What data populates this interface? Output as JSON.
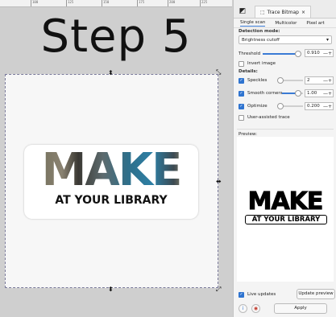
{
  "canvas": {
    "ruler_labels": [
      "100",
      "125",
      "150",
      "175",
      "200",
      "225"
    ],
    "step_title": "Step 5",
    "logo": {
      "main": "MAKE",
      "sub": "AT YOUR LIBRARY"
    }
  },
  "panel": {
    "tab_title": "Trace Bitmap",
    "tab_close": "×",
    "subtabs": [
      "Single scan",
      "Multicolor",
      "Pixel art"
    ],
    "detection_mode_label": "Detection mode:",
    "detection_mode_value": "Brightness cutoff",
    "threshold": {
      "label": "Threshold",
      "value": "0.910",
      "fraction": 0.91
    },
    "invert_image": {
      "label": "Invert image",
      "checked": false
    },
    "details_label": "Details:",
    "speckles": {
      "label": "Speckles",
      "value": "2",
      "checked": true,
      "fraction": 0.05
    },
    "smooth_corners": {
      "label": "Smooth corners",
      "value": "1.00",
      "checked": true,
      "fraction": 0.75
    },
    "optimize": {
      "label": "Optimize",
      "value": "0.200",
      "checked": true,
      "fraction": 0.05
    },
    "user_assisted": {
      "label": "User-assisted trace",
      "checked": false
    },
    "preview_label": "Preview:",
    "preview_logo": {
      "main": "MAKE",
      "sub": "AT YOUR LIBRARY"
    },
    "live_updates": {
      "label": "Live updates",
      "checked": true
    },
    "update_preview_label": "Update preview",
    "apply_label": "Apply",
    "plus_minus": "—+",
    "checkmark": "✓",
    "accent_color": "#3a7bd5"
  }
}
